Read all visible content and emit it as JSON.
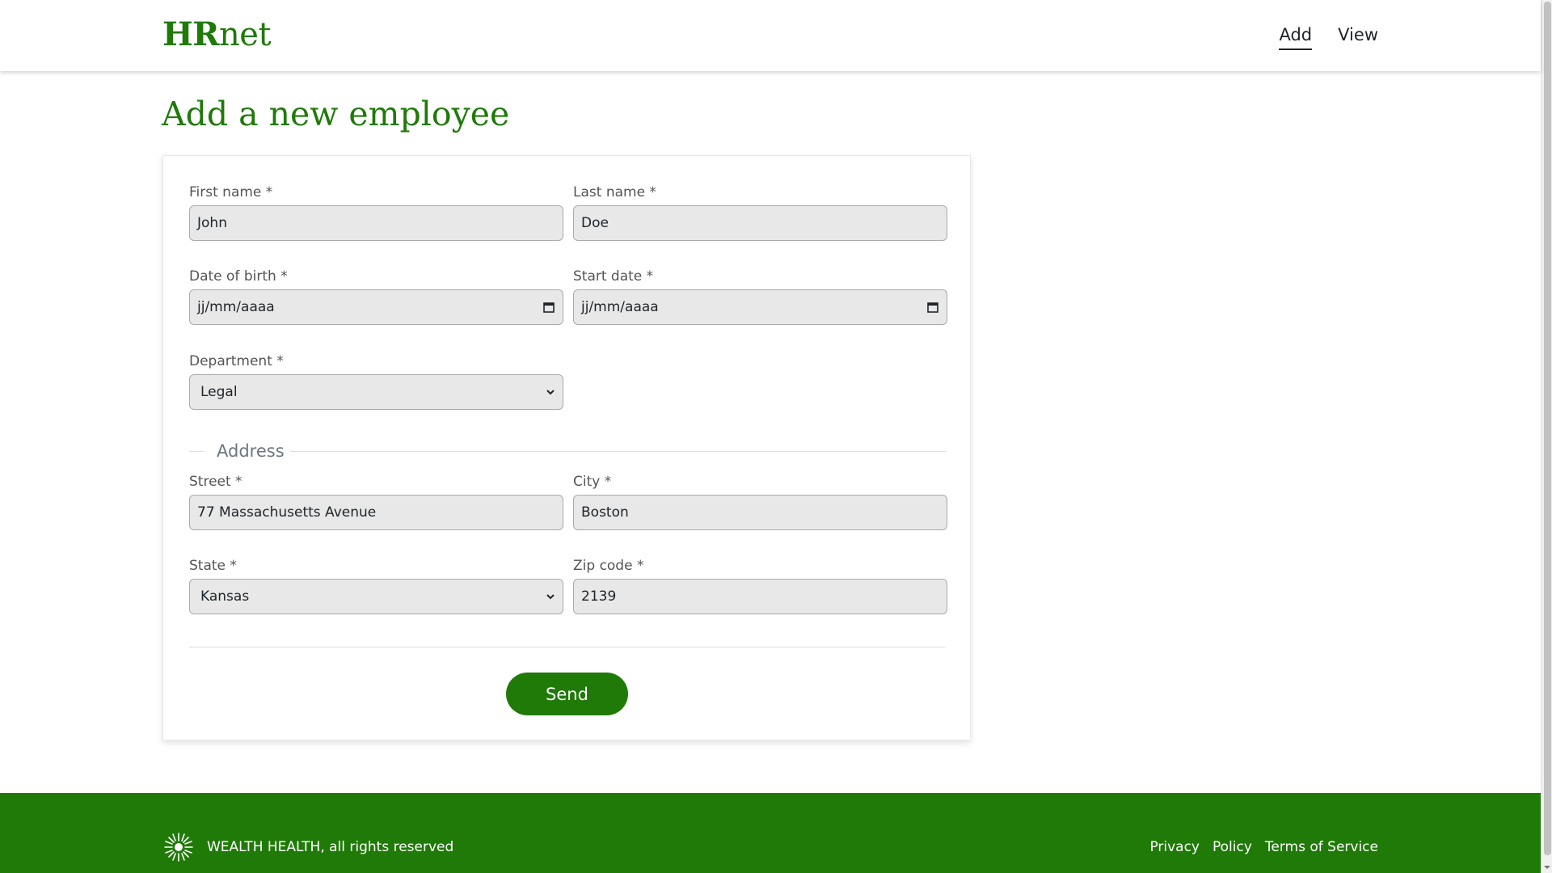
{
  "header": {
    "logo_bold": "HR",
    "logo_rest": "net",
    "nav": [
      {
        "label": "Add",
        "active": true
      },
      {
        "label": "View",
        "active": false
      }
    ]
  },
  "main": {
    "title": "Add a new employee",
    "form": {
      "first_name": {
        "label": "First name *",
        "value": "John"
      },
      "last_name": {
        "label": "Last name *",
        "value": "Doe"
      },
      "date_of_birth": {
        "label": "Date of birth *",
        "value": "jj/mm/aaaa",
        "icon": "calendar-icon"
      },
      "start_date": {
        "label": "Start date *",
        "value": "jj/mm/aaaa",
        "icon": "calendar-icon"
      },
      "department": {
        "label": "Department *",
        "value": "Legal",
        "icon": "chevron-down-icon"
      },
      "address_legend": "Address",
      "street": {
        "label": "Street *",
        "value": "77 Massachusetts Avenue"
      },
      "city": {
        "label": "City *",
        "value": "Boston"
      },
      "state": {
        "label": "State *",
        "value": "Kansas",
        "icon": "chevron-down-icon"
      },
      "zip": {
        "label": "Zip code *",
        "value": "2139"
      },
      "submit_label": "Send"
    }
  },
  "footer": {
    "logo_icon": "starburst-logo-icon",
    "copyright": "WEALTH HEALTH, all rights reserved",
    "links": [
      "Privacy",
      "Policy",
      "Terms of Service"
    ]
  },
  "colors": {
    "brand_green": "#1f7a08",
    "input_bg": "#e8e8e8",
    "text": "#212529"
  }
}
